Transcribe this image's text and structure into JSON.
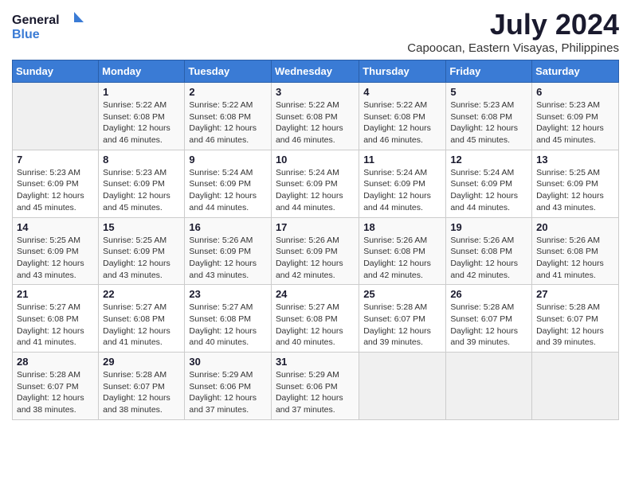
{
  "header": {
    "logo_line1": "General",
    "logo_line2": "Blue",
    "title": "July 2024",
    "subtitle": "Capoocan, Eastern Visayas, Philippines"
  },
  "columns": [
    "Sunday",
    "Monday",
    "Tuesday",
    "Wednesday",
    "Thursday",
    "Friday",
    "Saturday"
  ],
  "weeks": [
    [
      {
        "day": "",
        "info": ""
      },
      {
        "day": "1",
        "info": "Sunrise: 5:22 AM\nSunset: 6:08 PM\nDaylight: 12 hours\nand 46 minutes."
      },
      {
        "day": "2",
        "info": "Sunrise: 5:22 AM\nSunset: 6:08 PM\nDaylight: 12 hours\nand 46 minutes."
      },
      {
        "day": "3",
        "info": "Sunrise: 5:22 AM\nSunset: 6:08 PM\nDaylight: 12 hours\nand 46 minutes."
      },
      {
        "day": "4",
        "info": "Sunrise: 5:22 AM\nSunset: 6:08 PM\nDaylight: 12 hours\nand 46 minutes."
      },
      {
        "day": "5",
        "info": "Sunrise: 5:23 AM\nSunset: 6:08 PM\nDaylight: 12 hours\nand 45 minutes."
      },
      {
        "day": "6",
        "info": "Sunrise: 5:23 AM\nSunset: 6:09 PM\nDaylight: 12 hours\nand 45 minutes."
      }
    ],
    [
      {
        "day": "7",
        "info": "Sunrise: 5:23 AM\nSunset: 6:09 PM\nDaylight: 12 hours\nand 45 minutes."
      },
      {
        "day": "8",
        "info": "Sunrise: 5:23 AM\nSunset: 6:09 PM\nDaylight: 12 hours\nand 45 minutes."
      },
      {
        "day": "9",
        "info": "Sunrise: 5:24 AM\nSunset: 6:09 PM\nDaylight: 12 hours\nand 44 minutes."
      },
      {
        "day": "10",
        "info": "Sunrise: 5:24 AM\nSunset: 6:09 PM\nDaylight: 12 hours\nand 44 minutes."
      },
      {
        "day": "11",
        "info": "Sunrise: 5:24 AM\nSunset: 6:09 PM\nDaylight: 12 hours\nand 44 minutes."
      },
      {
        "day": "12",
        "info": "Sunrise: 5:24 AM\nSunset: 6:09 PM\nDaylight: 12 hours\nand 44 minutes."
      },
      {
        "day": "13",
        "info": "Sunrise: 5:25 AM\nSunset: 6:09 PM\nDaylight: 12 hours\nand 43 minutes."
      }
    ],
    [
      {
        "day": "14",
        "info": "Sunrise: 5:25 AM\nSunset: 6:09 PM\nDaylight: 12 hours\nand 43 minutes."
      },
      {
        "day": "15",
        "info": "Sunrise: 5:25 AM\nSunset: 6:09 PM\nDaylight: 12 hours\nand 43 minutes."
      },
      {
        "day": "16",
        "info": "Sunrise: 5:26 AM\nSunset: 6:09 PM\nDaylight: 12 hours\nand 43 minutes."
      },
      {
        "day": "17",
        "info": "Sunrise: 5:26 AM\nSunset: 6:09 PM\nDaylight: 12 hours\nand 42 minutes."
      },
      {
        "day": "18",
        "info": "Sunrise: 5:26 AM\nSunset: 6:08 PM\nDaylight: 12 hours\nand 42 minutes."
      },
      {
        "day": "19",
        "info": "Sunrise: 5:26 AM\nSunset: 6:08 PM\nDaylight: 12 hours\nand 42 minutes."
      },
      {
        "day": "20",
        "info": "Sunrise: 5:26 AM\nSunset: 6:08 PM\nDaylight: 12 hours\nand 41 minutes."
      }
    ],
    [
      {
        "day": "21",
        "info": "Sunrise: 5:27 AM\nSunset: 6:08 PM\nDaylight: 12 hours\nand 41 minutes."
      },
      {
        "day": "22",
        "info": "Sunrise: 5:27 AM\nSunset: 6:08 PM\nDaylight: 12 hours\nand 41 minutes."
      },
      {
        "day": "23",
        "info": "Sunrise: 5:27 AM\nSunset: 6:08 PM\nDaylight: 12 hours\nand 40 minutes."
      },
      {
        "day": "24",
        "info": "Sunrise: 5:27 AM\nSunset: 6:08 PM\nDaylight: 12 hours\nand 40 minutes."
      },
      {
        "day": "25",
        "info": "Sunrise: 5:28 AM\nSunset: 6:07 PM\nDaylight: 12 hours\nand 39 minutes."
      },
      {
        "day": "26",
        "info": "Sunrise: 5:28 AM\nSunset: 6:07 PM\nDaylight: 12 hours\nand 39 minutes."
      },
      {
        "day": "27",
        "info": "Sunrise: 5:28 AM\nSunset: 6:07 PM\nDaylight: 12 hours\nand 39 minutes."
      }
    ],
    [
      {
        "day": "28",
        "info": "Sunrise: 5:28 AM\nSunset: 6:07 PM\nDaylight: 12 hours\nand 38 minutes."
      },
      {
        "day": "29",
        "info": "Sunrise: 5:28 AM\nSunset: 6:07 PM\nDaylight: 12 hours\nand 38 minutes."
      },
      {
        "day": "30",
        "info": "Sunrise: 5:29 AM\nSunset: 6:06 PM\nDaylight: 12 hours\nand 37 minutes."
      },
      {
        "day": "31",
        "info": "Sunrise: 5:29 AM\nSunset: 6:06 PM\nDaylight: 12 hours\nand 37 minutes."
      },
      {
        "day": "",
        "info": ""
      },
      {
        "day": "",
        "info": ""
      },
      {
        "day": "",
        "info": ""
      }
    ]
  ]
}
